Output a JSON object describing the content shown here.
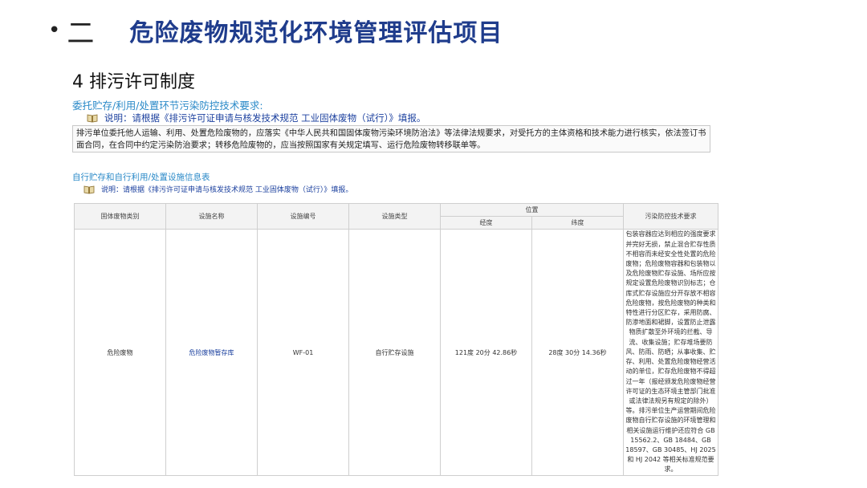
{
  "header": {
    "bullet": "•",
    "section_number": "二",
    "title": "危险废物规范化环境管理评估项目"
  },
  "subtitle": "4 排污许可制度",
  "section1": {
    "heading": "委托贮存/利用/处置环节污染防控技术要求:",
    "note": "说明：请根据《排污许可证申请与核发技术规范 工业固体废物（试行）》填报。",
    "description": "排污单位委托他人运输、利用、处置危险废物的，应落实《中华人民共和国固体废物污染环境防治法》等法律法规要求，对受托方的主体资格和技术能力进行核实，依法签订书面合同，在合同中约定污染防治要求；转移危险废物的，应当按照国家有关规定填写、运行危险废物转移联单等。"
  },
  "section2": {
    "heading": "自行贮存和自行利用/处置设施信息表",
    "note": "说明：请根据《排污许可证申请与核发技术规范 工业固体废物（试行）》填报。"
  },
  "table": {
    "headers": {
      "category": "固体废物类别",
      "facility_name": "设施名称",
      "facility_code": "设施编号",
      "facility_type": "设施类型",
      "location": "位置",
      "longitude": "经度",
      "latitude": "纬度",
      "tech_requirements": "污染防控技术要求"
    },
    "row": {
      "category": "危险废物",
      "facility_name": "危险废物暂存库",
      "facility_code": "WF-01",
      "facility_type": "自行贮存设施",
      "longitude": "121度 20分 42.86秒",
      "latitude": "28度 30分 14.36秒",
      "tech_requirements": "包装容器应达到相应的强度要求并完好无损，禁止混合贮存性质不相容而未经安全性处置的危险废物；危险废物容器和包装物以及危险废物贮存设施、场所应按规定设置危险废物识别标志；仓库式贮存设施应分开存放不相容危险废物，按危险废物的种类和特性进行分区贮存，采用防腐、防渗地面和裙脚，设置防止泄露物质扩散至外环境的拦截、导流、收集设施；贮存堆场要防风、防雨、防晒；从事收集、贮存、利用、处置危险废物经营活动的单位，贮存危险废物不得超过一年（报经颁发危险废物经营许可证的生态环境主管部门批准或法律法规另有规定的除外）等。排污单位生产运营期间危险废物自行贮存设施的环境管理和相关设施运行维护还应符合 GB 15562.2、GB 18484、GB 18597、GB 30485、HJ 2025 和 HJ 2042 等相关标准规范要求。"
    }
  },
  "colors": {
    "title": "#1f3c8c",
    "heading": "#2b8ac8",
    "note": "#1a3f9e"
  },
  "icons": [
    "book-icon"
  ]
}
